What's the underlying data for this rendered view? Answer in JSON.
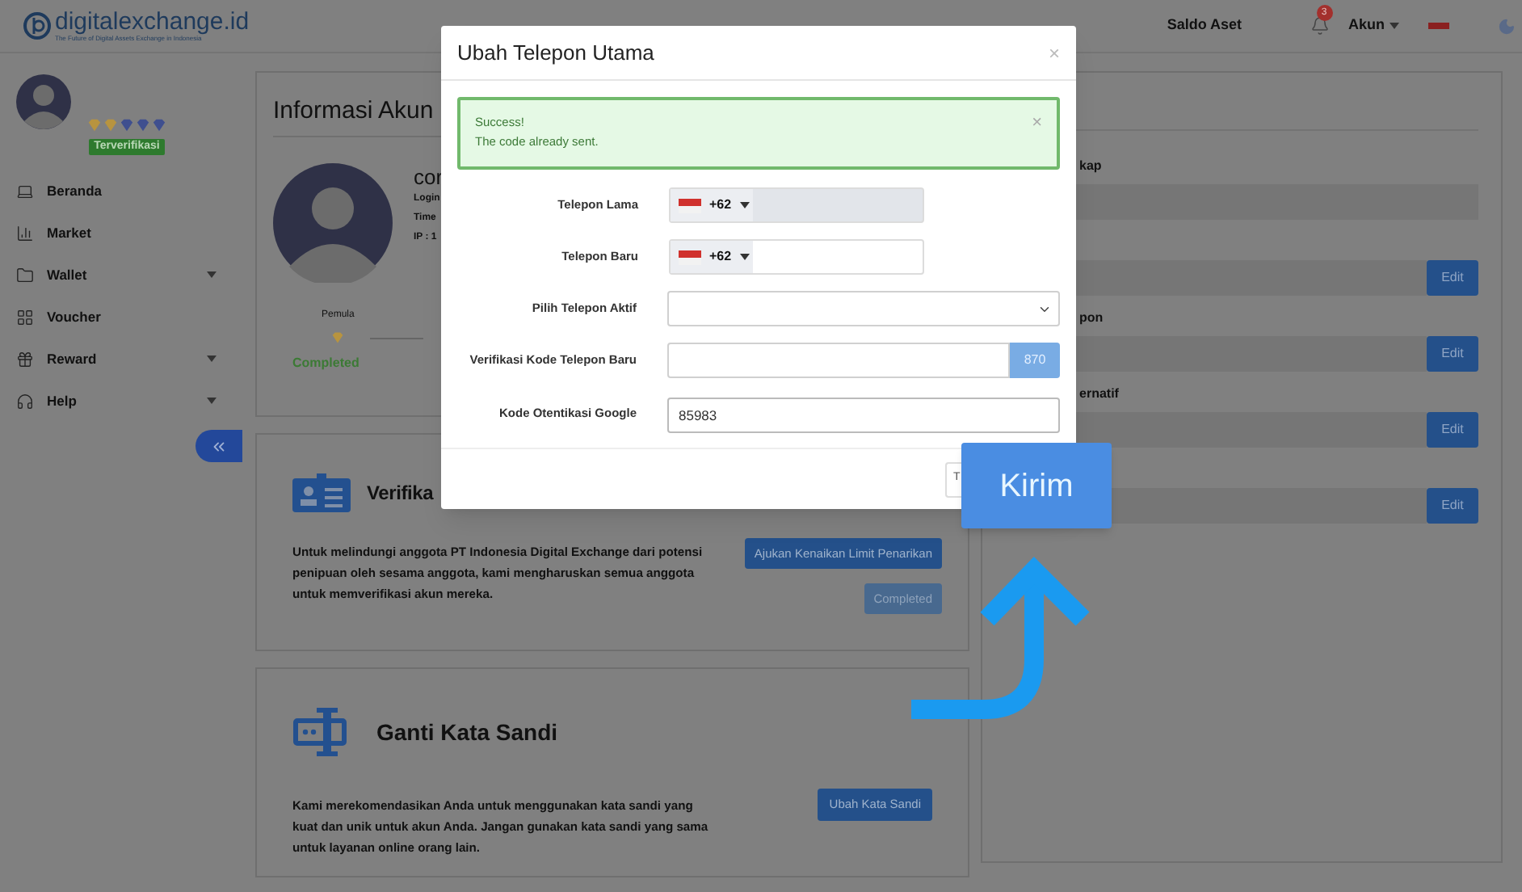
{
  "header": {
    "logo": {
      "name": "digitalexchange.id",
      "tagline": "The Future of Digital Assets Exchange in Indonesia"
    },
    "balance_link": "Saldo Aset",
    "notifications": {
      "count": "3"
    },
    "account_menu": "Akun"
  },
  "sidebar": {
    "profile": {
      "badges": [
        {
          "color": "#b8943f"
        },
        {
          "color": "#b8943f"
        },
        {
          "color": "#3f4f8f"
        },
        {
          "color": "#3f4f8f"
        },
        {
          "color": "#3f4f8f"
        }
      ],
      "status": "Terverifikasi"
    },
    "items": [
      {
        "label": "Beranda",
        "has_submenu": false
      },
      {
        "label": "Market",
        "has_submenu": false
      },
      {
        "label": "Wallet",
        "has_submenu": true
      },
      {
        "label": "Voucher",
        "has_submenu": false
      },
      {
        "label": "Reward",
        "has_submenu": true
      },
      {
        "label": "Help",
        "has_submenu": true
      }
    ]
  },
  "account_card": {
    "title": "Informasi Akun",
    "name": "cor",
    "details": [
      "Login",
      "Time",
      "IP : 1"
    ],
    "level": {
      "label": "Pemula",
      "status": "Completed"
    }
  },
  "verification_card": {
    "title": "Verifika",
    "text": "Untuk melindungi anggota PT Indonesia Digital Exchange dari potensi penipuan oleh sesama anggota, kami mengharuskan semua anggota untuk memverifikasi akun mereka.",
    "buttons": [
      {
        "label": "Ajukan Kenaikan Limit Penarikan",
        "disabled": false
      },
      {
        "label": "Completed",
        "disabled": true
      }
    ]
  },
  "password_card": {
    "title": "Ganti Kata Sandi",
    "text": "Kami merekomendasikan Anda untuk menggunakan kata sandi yang kuat dan unik untuk akun Anda. Jangan gunakan kata sandi yang sama untuk layanan online orang lain.",
    "button": "Ubah Kata Sandi"
  },
  "profile_fields": [
    {
      "label": "kap"
    },
    {
      "button": "Edit"
    },
    {
      "label": "pon",
      "button": "Edit"
    },
    {
      "label": "ernatif",
      "button": "Edit"
    },
    {
      "button": "Edit"
    }
  ],
  "modal": {
    "title": "Ubah Telepon Utama",
    "close": "×",
    "alert": {
      "title": "Success!",
      "message": "The code already sent.",
      "close": "×"
    },
    "fields": [
      {
        "kind": "phone",
        "label": "Telepon Lama",
        "code": "+62",
        "disabled": true
      },
      {
        "kind": "phone",
        "label": "Telepon Baru",
        "code": "+62",
        "disabled": false
      },
      {
        "kind": "select",
        "label": "Pilih Telepon Aktif"
      },
      {
        "kind": "code",
        "label": "Verifikasi Kode Telepon Baru",
        "button": "870"
      },
      {
        "kind": "text",
        "label": "Kode Otentikasi Google",
        "value": "85983"
      }
    ],
    "footer_button": "T"
  },
  "callout": {
    "label": "Kirim"
  }
}
